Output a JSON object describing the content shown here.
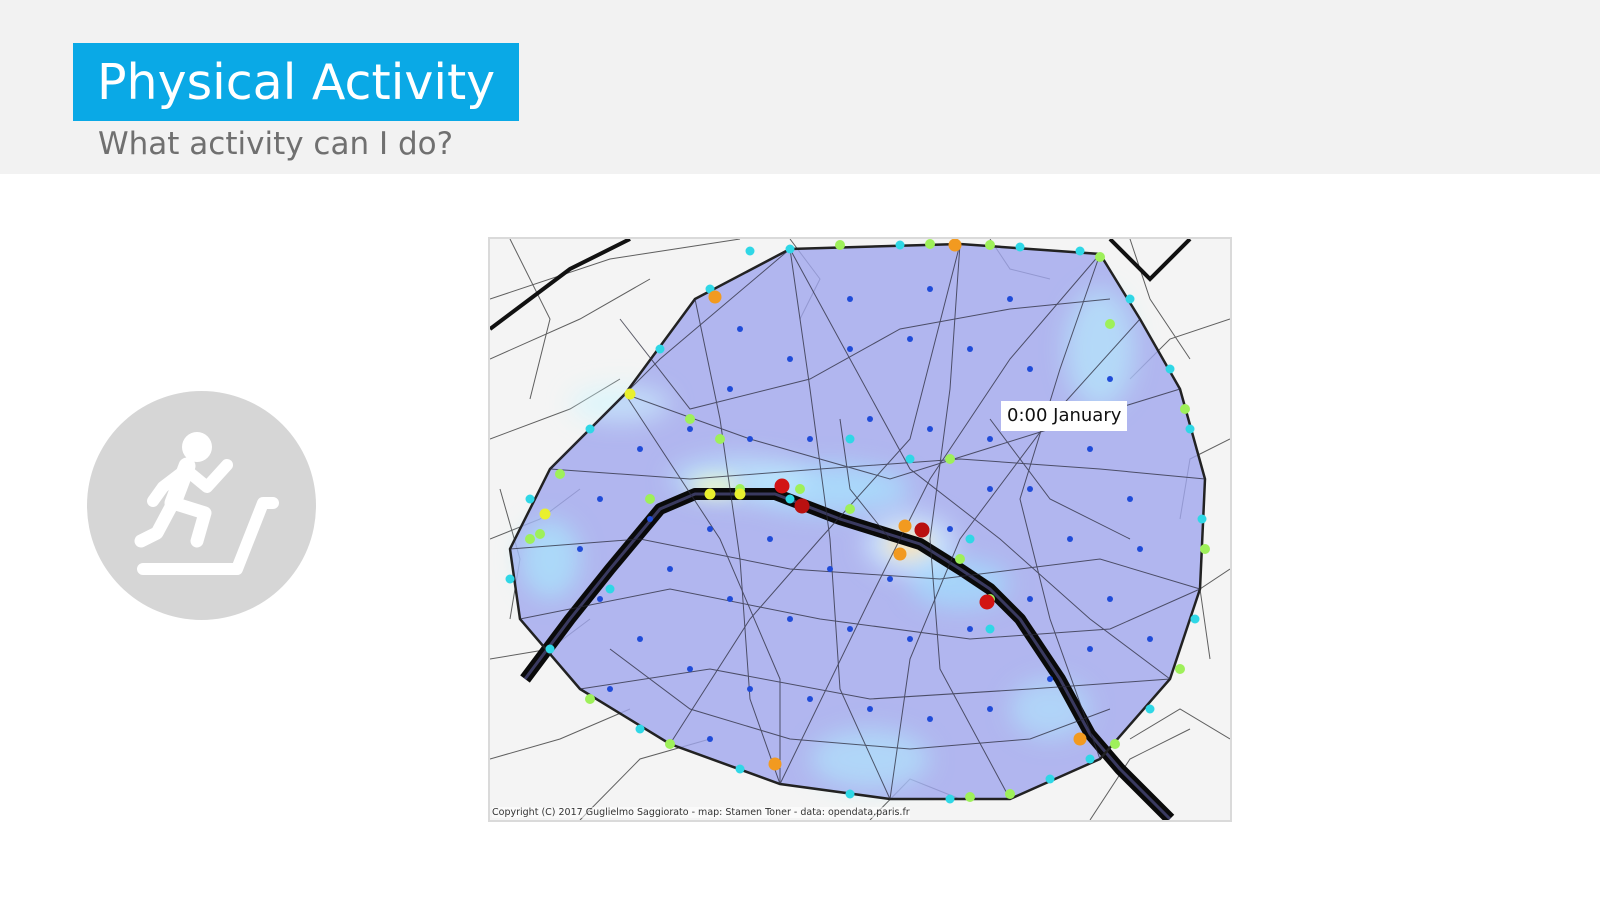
{
  "slide": {
    "title": "Physical Activity",
    "subtitle": "What activity can I do?"
  },
  "icon": "treadmill-runner-icon",
  "map": {
    "time_label": "0:00 January",
    "copyright": "Copyright (C) 2017 Guglielmo Saggiorato - map: Stamen Toner - data: opendata.paris.fr"
  },
  "colors": {
    "title_bg": "#0aa9e6",
    "header_band": "#f2f2f2",
    "subtitle": "#707070",
    "icon_circle": "#d6d6d6",
    "heat_fill": "#a0a6ee",
    "hot": "#d21414",
    "warm": "#f29a20",
    "mid": "#9ef05a",
    "cool": "#2fd7e6",
    "cold": "#1f4bd8"
  }
}
